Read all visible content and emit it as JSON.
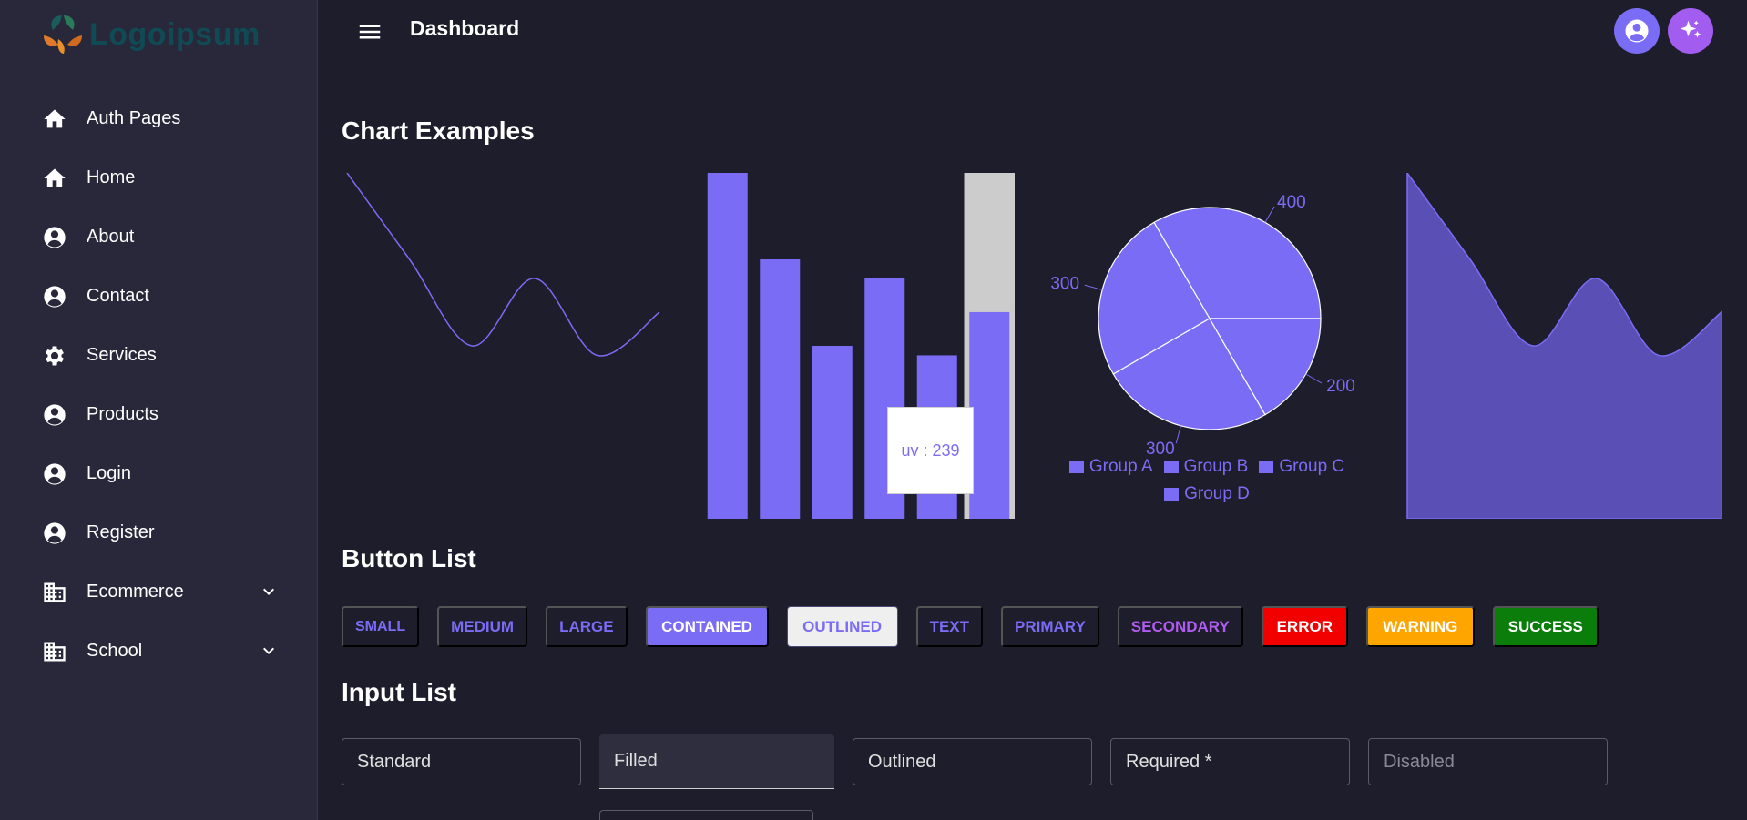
{
  "sidebar": {
    "logo": "Logoipsum",
    "items": [
      {
        "label": "Auth Pages",
        "icon": "home-icon"
      },
      {
        "label": "Home",
        "icon": "home-icon"
      },
      {
        "label": "About",
        "icon": "account-circle-icon"
      },
      {
        "label": "Contact",
        "icon": "account-circle-icon"
      },
      {
        "label": "Services",
        "icon": "gear-icon"
      },
      {
        "label": "Products",
        "icon": "account-circle-icon"
      },
      {
        "label": "Login",
        "icon": "account-circle-icon"
      },
      {
        "label": "Register",
        "icon": "account-circle-icon"
      },
      {
        "label": "Ecommerce",
        "icon": "building-icon",
        "expandable": true
      },
      {
        "label": "School",
        "icon": "building-icon",
        "expandable": true
      }
    ]
  },
  "header": {
    "title": "Dashboard"
  },
  "sections": {
    "charts": "Chart Examples",
    "buttons": "Button List",
    "inputs": "Input List"
  },
  "colors": {
    "accent": "#7b6cf6",
    "secondary": "#b05cf0",
    "error": "#f20000",
    "warning": "#ffa500",
    "success": "#0a7d0a"
  },
  "chart_data": [
    {
      "type": "line",
      "x": [
        0,
        1,
        2,
        3,
        4,
        5
      ],
      "values": [
        400,
        300,
        200,
        278,
        189,
        239
      ],
      "ylim": [
        0,
        400
      ]
    },
    {
      "type": "bar",
      "values": [
        400,
        300,
        200,
        278,
        189,
        239
      ],
      "highlight_index": 5,
      "tooltip": "uv : 239",
      "ylim": [
        0,
        400
      ]
    },
    {
      "type": "pie",
      "series": [
        {
          "name": "Group A",
          "value": 400
        },
        {
          "name": "Group B",
          "value": 300
        },
        {
          "name": "Group C",
          "value": 300
        },
        {
          "name": "Group D",
          "value": 200
        }
      ],
      "labels": [
        "400",
        "300",
        "300",
        "200"
      ],
      "legend": "bottom"
    },
    {
      "type": "area",
      "x": [
        0,
        1,
        2,
        3,
        4,
        5
      ],
      "values": [
        400,
        300,
        200,
        278,
        189,
        239
      ],
      "ylim": [
        0,
        400
      ]
    }
  ],
  "buttons": [
    {
      "label": "Small",
      "variant": "text-small"
    },
    {
      "label": "Medium",
      "variant": "text"
    },
    {
      "label": "Large",
      "variant": "text"
    },
    {
      "label": "Contained",
      "variant": "contained"
    },
    {
      "label": "Outlined",
      "variant": "outlined"
    },
    {
      "label": "Text",
      "variant": "text"
    },
    {
      "label": "Primary",
      "variant": "text"
    },
    {
      "label": "Secondary",
      "variant": "secondary"
    },
    {
      "label": "Error",
      "variant": "error"
    },
    {
      "label": "Warning",
      "variant": "warning"
    },
    {
      "label": "Success",
      "variant": "success"
    }
  ],
  "inputs": [
    {
      "label": "Standard",
      "variant": "outlined"
    },
    {
      "label": "Filled",
      "variant": "filled"
    },
    {
      "label": "Outlined",
      "variant": "outlined"
    },
    {
      "label": "Required *",
      "variant": "outlined"
    },
    {
      "label": "Disabled",
      "variant": "disabled"
    }
  ]
}
